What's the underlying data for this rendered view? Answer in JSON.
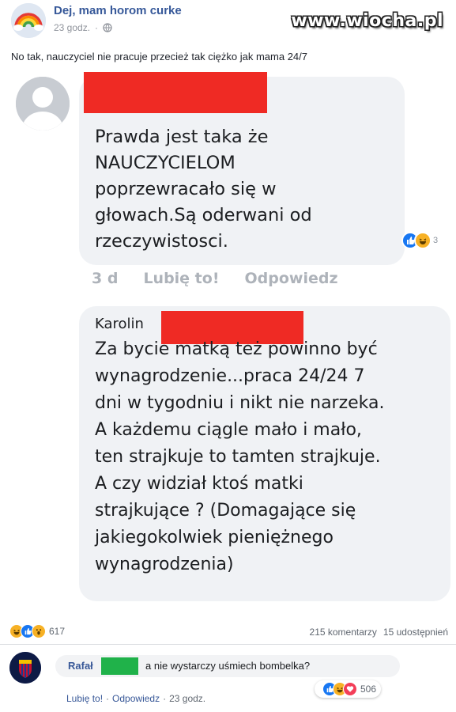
{
  "post": {
    "page_name": "Dej, mam horom curke",
    "time": "23 godz.",
    "text": "No tak, nauczyciel nie pracuje przecież tak ciężko jak mama 24/7",
    "watermark": "www.wiocha.pl"
  },
  "screenshot": {
    "comment_1": {
      "text": "Prawda jest taka że\nNAUCZYCIELOM\npoprzewracało się w\ngłowach.Są oderwani od\nrzeczywistosci.",
      "reaction_count": "3",
      "age": "3 d",
      "like_label": "Lubię to!",
      "reply_label": "Odpowiedz"
    },
    "comment_2": {
      "author": "Karolin",
      "text": "Za bycie matką też powinno być\nwynagrodzenie...praca 24/24 7\ndni w tygodniu i nikt nie narzeka.\nA każdemu ciągle mało i mało,\nten strajkuje to tamten strajkuje.\nA czy widział ktoś matki\nstrajkujące ? (Domagające się\njakiegokolwiek pieniężnego\nwynagrodzenia)"
    }
  },
  "stats": {
    "reaction_count": "617",
    "comments": "215 komentarzy",
    "shares": "15 udostępnień"
  },
  "reply": {
    "author": "Rafał",
    "text": "a nie wystarczy uśmiech bombelka?",
    "reaction_count": "506",
    "like_label": "Lubię to!",
    "reply_label": "Odpowiedz",
    "time": "23 godz.",
    "separator": "·"
  },
  "colors": {
    "link_blue": "#365899",
    "like_blue": "#1877f2",
    "haha_yellow": "#f7b125",
    "love_red": "#f33e58",
    "redaction_red": "#ef2a24",
    "redaction_green": "#20b24a"
  },
  "icons": [
    "rainbow-avatar-icon",
    "globe-icon",
    "default-avatar-icon",
    "like-reaction-icon",
    "haha-reaction-icon",
    "wow-reaction-icon",
    "love-reaction-icon",
    "fc-barcelona-crest-icon"
  ]
}
